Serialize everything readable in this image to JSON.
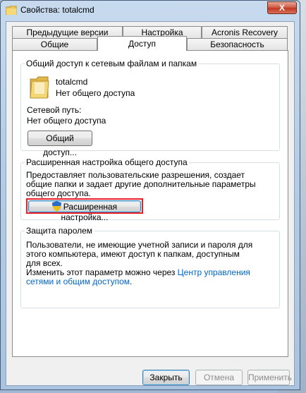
{
  "window": {
    "title": "Свойства: totalcmd",
    "close_label": "X"
  },
  "tabs_row1": [
    {
      "label": "Предыдущие версии"
    },
    {
      "label": "Настройка"
    },
    {
      "label": "Acronis Recovery"
    }
  ],
  "tabs_row2": [
    {
      "label": "Общие"
    },
    {
      "label": "Доступ"
    },
    {
      "label": "Безопасность"
    }
  ],
  "sharing": {
    "group_title": "Общий доступ к сетевым файлам и папкам",
    "folder_name": "totalcmd",
    "folder_status": "Нет общего доступа",
    "network_path_label": "Сетевой путь:",
    "network_path_value": "Нет общего доступа",
    "share_button": "Общий доступ..."
  },
  "advanced": {
    "group_title": "Расширенная настройка общего доступа",
    "description_lines": [
      "Предоставляет пользовательские разрешения, создает",
      "общие папки и задает другие дополнительные параметры",
      "общего доступа."
    ],
    "button": "Расширенная настройка..."
  },
  "password": {
    "group_title": "Защита паролем",
    "description_lines": [
      "Пользователи, не имеющие учетной записи и пароля для",
      "этого компьютера, имеют доступ к папкам, доступным",
      "для всех."
    ],
    "change_text": "Изменить этот параметр можно через ",
    "link_line1": "Центр управления",
    "link_line2": "сетями и общим доступом",
    "link_suffix": "."
  },
  "footer": {
    "close_button": "Закрыть",
    "cancel_button": "Отмена",
    "apply_button": "Применить"
  }
}
